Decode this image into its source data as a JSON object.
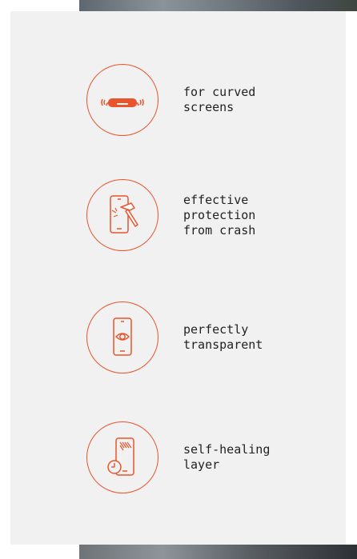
{
  "accent_color": "#e8552c",
  "features": [
    {
      "icon": "curved-screen-icon",
      "label": "for curved\nscreens"
    },
    {
      "icon": "hammer-phone-icon",
      "label": "effective\nprotection\nfrom crash"
    },
    {
      "icon": "eye-phone-icon",
      "label": "perfectly\ntransparent"
    },
    {
      "icon": "self-healing-phone-icon",
      "label": "self-healing\nlayer"
    }
  ]
}
